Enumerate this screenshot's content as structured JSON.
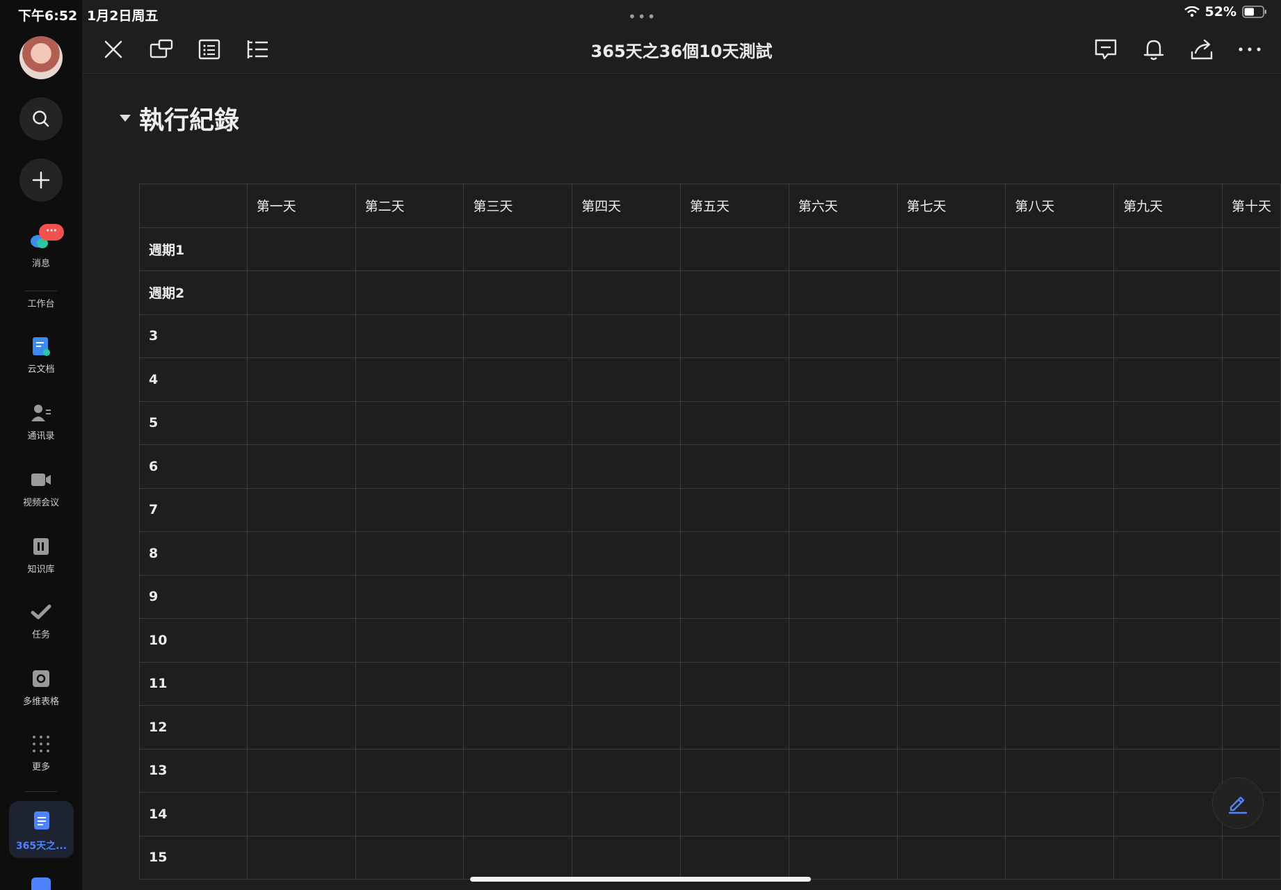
{
  "status_bar": {
    "time": "下午6:52",
    "date": "1月2日周五",
    "battery": "52%"
  },
  "sidebar": {
    "items": [
      {
        "label": "消息",
        "icon": "chat-bubble-icon"
      },
      {
        "label": "工作台",
        "icon": ""
      },
      {
        "label": "云文档",
        "icon": "cloud-doc-icon"
      },
      {
        "label": "通讯录",
        "icon": "contacts-icon"
      },
      {
        "label": "视频会议",
        "icon": "video-icon"
      },
      {
        "label": "知识库",
        "icon": "knowledge-base-icon"
      },
      {
        "label": "任务",
        "icon": "task-check-icon"
      },
      {
        "label": "多维表格",
        "icon": "base-table-icon"
      },
      {
        "label": "更多",
        "icon": "more-grid-icon"
      }
    ],
    "messages_badge": "···",
    "active_doc_label": "365天之..."
  },
  "toolbar": {
    "title": "365天之36個10天測試"
  },
  "section": {
    "heading": "執行紀錄"
  },
  "table": {
    "columns": [
      "",
      "第一天",
      "第二天",
      "第三天",
      "第四天",
      "第五天",
      "第六天",
      "第七天",
      "第八天",
      "第九天",
      "第十天"
    ],
    "rows": [
      "週期1",
      "週期2",
      "3",
      "4",
      "5",
      "6",
      "7",
      "8",
      "9",
      "10",
      "11",
      "12",
      "13",
      "14",
      "15"
    ]
  },
  "colors": {
    "accent": "#4e83fd",
    "background": "#1e1e1e",
    "sidebar": "#0e0e0e",
    "badge": "#f0524e"
  }
}
